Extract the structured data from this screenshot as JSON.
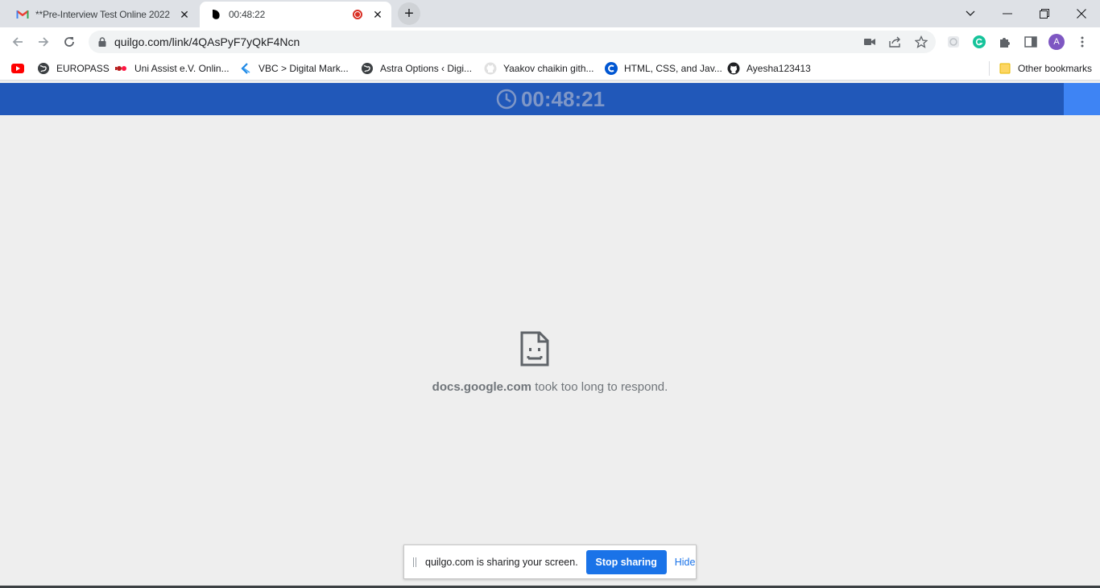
{
  "tabs": [
    {
      "title": "**Pre-Interview Test Online 2022",
      "favicon": "gmail-icon"
    },
    {
      "title": "00:48:22",
      "favicon": "quilgo-icon",
      "recording": true
    }
  ],
  "address_bar": {
    "url": "quilgo.com/link/4QAsPyF7yQkF4Ncn"
  },
  "profile": {
    "initial": "A"
  },
  "bookmarks": [
    {
      "label": "",
      "icon": "youtube-icon"
    },
    {
      "label": "EUROPASS",
      "icon": "globe-icon"
    },
    {
      "label": "Uni Assist e.V. Onlin...",
      "icon": "uniassist-icon"
    },
    {
      "label": "VBC > Digital Mark...",
      "icon": "vbc-icon"
    },
    {
      "label": "Astra Options ‹ Digi...",
      "icon": "globe-icon"
    },
    {
      "label": "Yaakov chaikin gith...",
      "icon": "github-icon"
    },
    {
      "label": "HTML, CSS, and Jav...",
      "icon": "coursera-icon"
    },
    {
      "label": "Ayesha123413",
      "icon": "github-icon"
    }
  ],
  "other_bookmarks": "Other bookmarks",
  "timer": {
    "value": "00:48:21"
  },
  "error": {
    "host": "docs.google.com",
    "message": " took too long to respond."
  },
  "sharing": {
    "message": "quilgo.com is sharing your screen.",
    "stop_label": "Stop sharing",
    "hide_label": "Hide"
  },
  "colors": {
    "timer_bar": "#2158b9",
    "accent": "#1a73e8",
    "record": "#d93025"
  }
}
